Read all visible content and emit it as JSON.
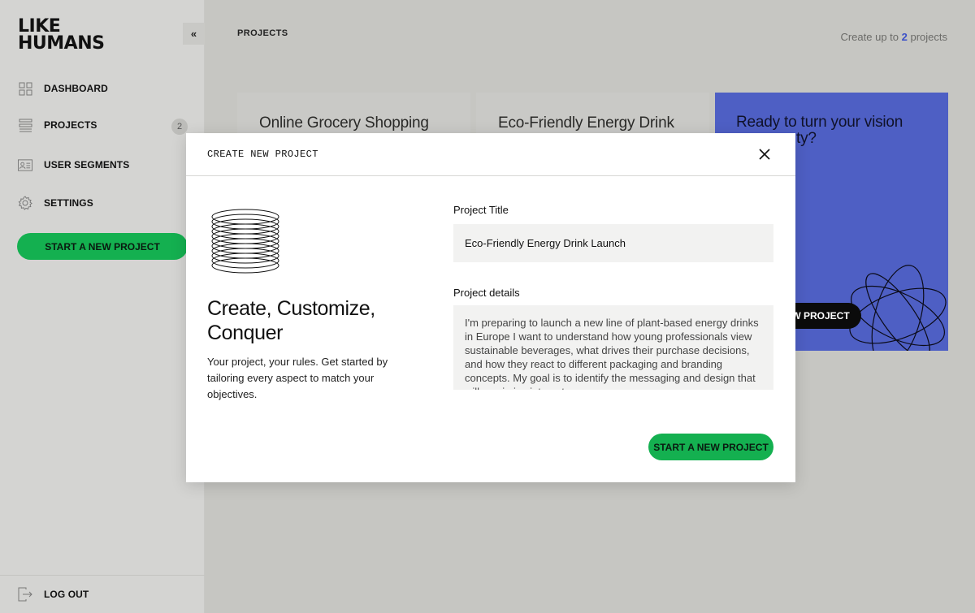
{
  "sidebar": {
    "logo_line1": "LIKE",
    "logo_line2": "HUMANS",
    "collapse_label": "«",
    "items": [
      {
        "label": "DASHBOARD",
        "icon": "grid-icon"
      },
      {
        "label": "PROJECTS",
        "icon": "list-icon",
        "badge": "2"
      },
      {
        "label": "USER SEGMENTS",
        "icon": "id-card-icon"
      },
      {
        "label": "SETTINGS",
        "icon": "gear-icon"
      }
    ],
    "cta_label": "START A NEW PROJECT",
    "logout_label": "LOG OUT"
  },
  "header": {
    "breadcrumb": "PROJECTS",
    "quota_prefix": "Create up to ",
    "quota_count": "2",
    "quota_suffix": " projects"
  },
  "cards": [
    {
      "title": "Online Grocery Shopping"
    },
    {
      "title": "Eco-Friendly Energy Drink"
    }
  ],
  "cta_card": {
    "title_line1": "Ready to turn your vision",
    "title_line2": "ty?",
    "button_label": "EW PROJECT",
    "color": "#4e5fc4"
  },
  "modal": {
    "title": "CREATE NEW PROJECT",
    "hero_line1": "Create, Customize,",
    "hero_line2": "Conquer",
    "hero_sub": "Your project, your rules. Get started by tailoring every aspect to match your objectives.",
    "project_title_label": "Project Title",
    "project_title_value": "Eco-Friendly Energy Drink Launch",
    "details_label": "Project details",
    "details_value": "I'm preparing to launch a new line of plant-based energy drinks in Europe I want to understand how young professionals view sustainable beverages, what drives their purchase decisions, and how they react to different packaging and branding concepts. My goal is to identify the messaging and design that will maximize interest.",
    "submit_label": "START A NEW PROJECT"
  },
  "colors": {
    "accent_green": "#14b050",
    "accent_blue": "#3b50c8"
  }
}
